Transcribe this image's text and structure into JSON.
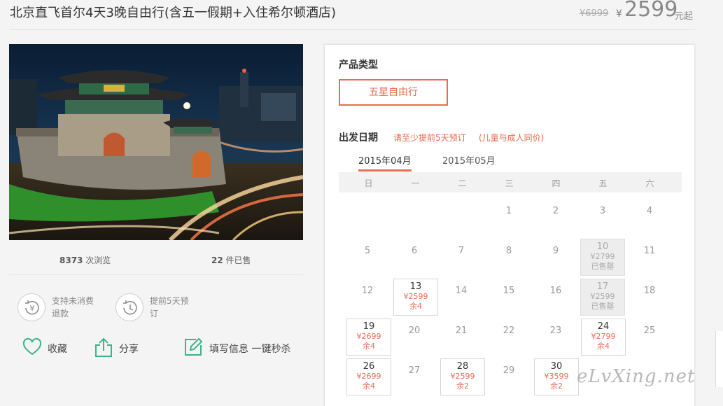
{
  "product": {
    "title": "北京直飞首尔4天3晚自由行(含五一假期+入住希尔顿酒店)",
    "old_price": "¥6999",
    "currency": "¥",
    "price": "2599",
    "price_unit": "元起"
  },
  "stats": {
    "views_count": "8373",
    "views_label": "次浏览",
    "sold_count": "22",
    "sold_label": "件已售"
  },
  "features": [
    {
      "icon": "yen-refund-icon",
      "line1": "支持未消费",
      "line2": "退款"
    },
    {
      "icon": "clock-history-icon",
      "line1": "提前5天预",
      "line2": "订"
    }
  ],
  "actions": {
    "favorite": "收藏",
    "share": "分享",
    "fill_info": "填写信息 一键秒杀"
  },
  "booking": {
    "product_type_label": "产品类型",
    "product_type_option": "五星自由行",
    "departure_label": "出发日期",
    "note1": "请至少提前5天预订",
    "note2": "(儿童与成人同价)",
    "months": [
      "2015年04月",
      "2015年05月"
    ],
    "weekdays": [
      "日",
      "一",
      "二",
      "三",
      "四",
      "五",
      "六"
    ]
  },
  "calendar": {
    "d1": "1",
    "d2": "2",
    "d3": "3",
    "d4": "4",
    "d5": "5",
    "d6": "6",
    "d7": "7",
    "d8": "8",
    "d9": "9",
    "d10": "10",
    "d10p": "¥2799",
    "d10s": "已售罄",
    "d11": "11",
    "d12": "12",
    "d13": "13",
    "d13p": "¥2599",
    "d13s": "余4",
    "d14": "14",
    "d15": "15",
    "d16": "16",
    "d17": "17",
    "d17p": "¥2599",
    "d17s": "已售罄",
    "d18": "18",
    "d19": "19",
    "d19p": "¥2699",
    "d19s": "余4",
    "d20": "20",
    "d21": "21",
    "d22": "22",
    "d23": "23",
    "d24": "24",
    "d24p": "¥2799",
    "d24s": "余4",
    "d25": "25",
    "d26": "26",
    "d26p": "¥2699",
    "d26s": "余4",
    "d27": "27",
    "d28": "28",
    "d28p": "¥2599",
    "d28s": "余2",
    "d29": "29",
    "d30": "30",
    "d30p": "¥3599",
    "d30s": "余2"
  },
  "watermark": "eLvXing.net",
  "colors": {
    "accent": "#e96c53",
    "like_icon": "#3cb38a"
  }
}
